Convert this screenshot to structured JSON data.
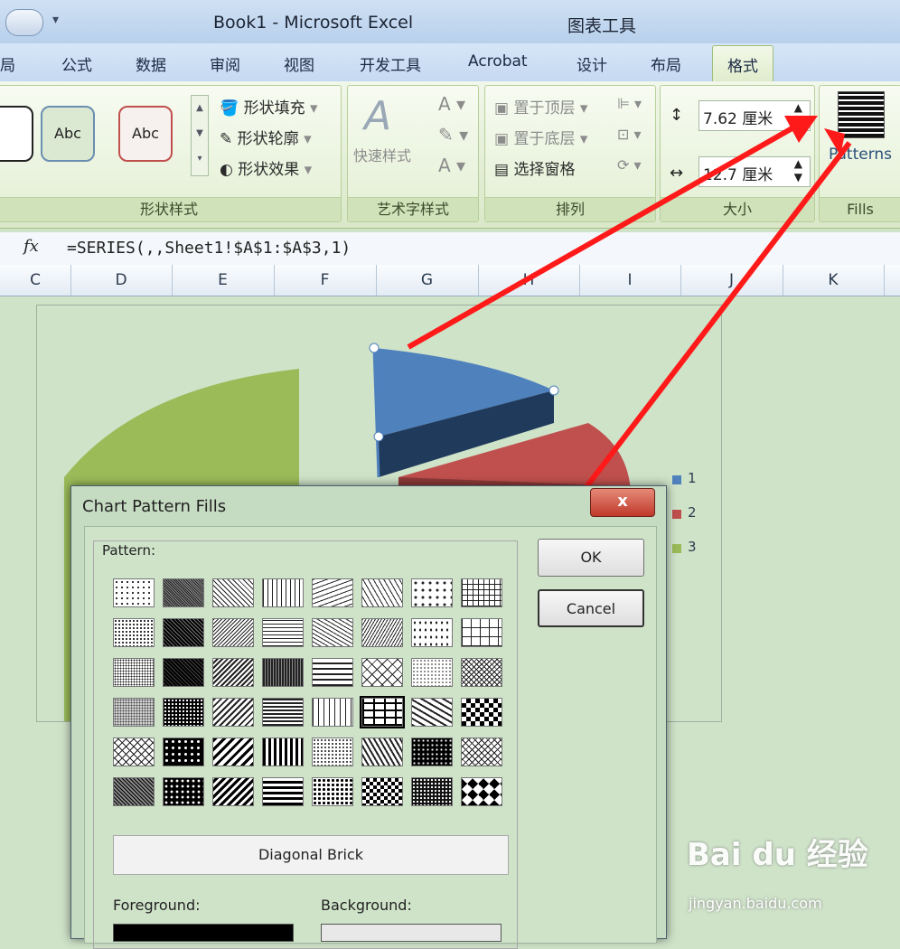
{
  "window": {
    "title": "Book1 - Microsoft Excel",
    "chart_tools": "图表工具"
  },
  "tabs": {
    "left_partial": "局",
    "items": [
      "公式",
      "数据",
      "审阅",
      "视图",
      "开发工具",
      "Acrobat",
      "设计",
      "布局",
      "格式"
    ],
    "active": "格式"
  },
  "ribbon": {
    "shape_style": {
      "label": "形状样式",
      "buttons": [
        "Abc",
        "Abc"
      ],
      "fill": "形状填充",
      "outline": "形状轮廓",
      "effect": "形状效果"
    },
    "wordart": {
      "label": "艺术字样式",
      "quick": "快速样式"
    },
    "arrange": {
      "label": "排列",
      "bring_front": "置于顶层",
      "send_back": "置于底层",
      "selection_pane": "选择窗格"
    },
    "size": {
      "label": "大小",
      "height": "7.62 厘米",
      "width": "12.7 厘米"
    },
    "fills": {
      "label": "Fills",
      "patterns": "Patterns"
    }
  },
  "formula_bar": {
    "fx": "fx",
    "formula": "=SERIES(,,Sheet1!$A$1:$A$3,1)"
  },
  "columns": [
    "C",
    "D",
    "E",
    "F",
    "G",
    "H",
    "I",
    "J",
    "K"
  ],
  "chart": {
    "legend": [
      "1",
      "2",
      "3"
    ],
    "colors": {
      "s1": "#4f81bd",
      "s2": "#c0504d",
      "s3": "#9bbb59"
    }
  },
  "dialog": {
    "title": "Chart Pattern Fills",
    "close": "x",
    "pattern_label": "Pattern:",
    "ok": "OK",
    "cancel": "Cancel",
    "selected_pattern": "Diagonal Brick",
    "foreground_label": "Foreground:",
    "background_label": "Background:"
  },
  "watermark": {
    "text": "Bai du 经验",
    "sub": "jingyan.baidu.com"
  }
}
